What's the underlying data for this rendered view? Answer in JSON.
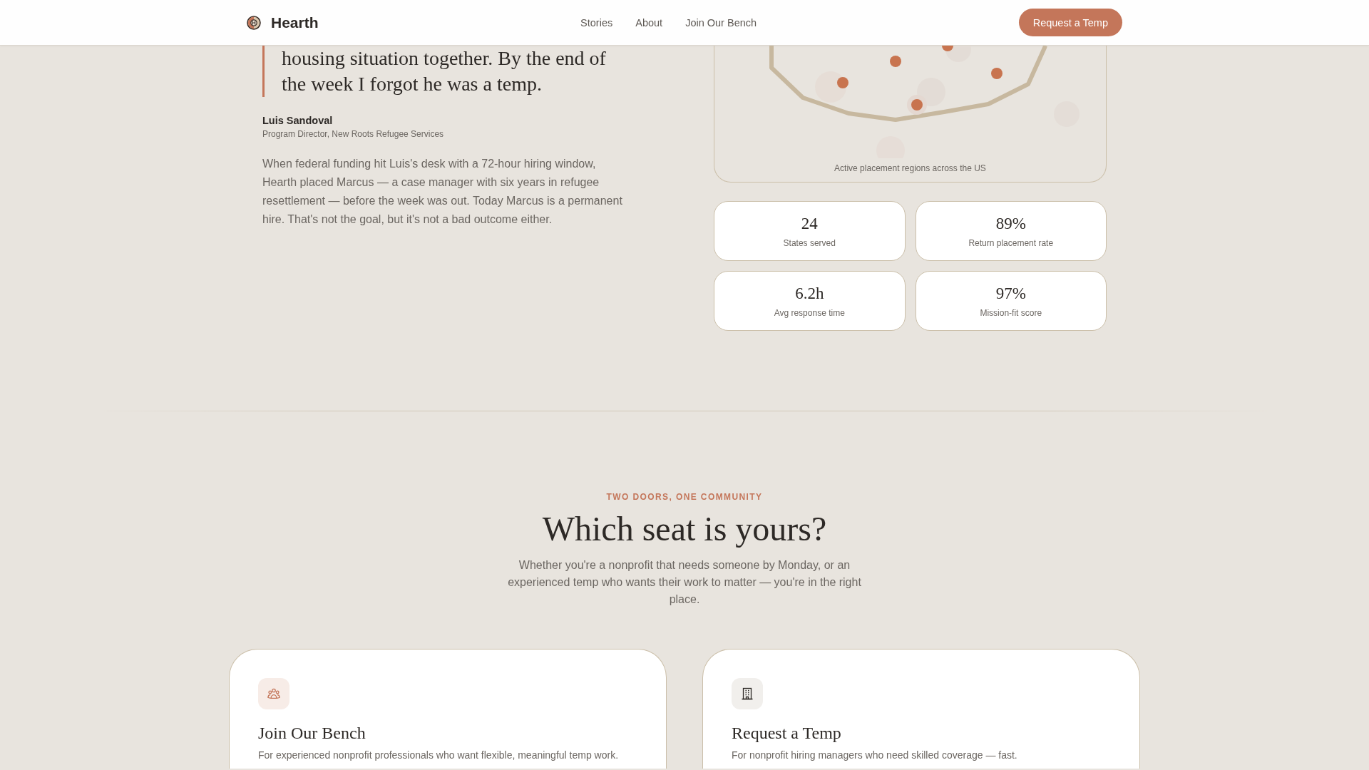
{
  "header": {
    "brand": "Hearth",
    "nav": [
      {
        "label": "Stories"
      },
      {
        "label": "About"
      },
      {
        "label": "Join Our Bench"
      }
    ],
    "cta": "Request a Temp"
  },
  "testimonial": {
    "quote": "housing situation together. By the end of the week I forgot he was a temp.",
    "author": "Luis Sandoval",
    "role": "Program Director, New Roots Refugee Services",
    "story": "When federal funding hit Luis's desk with a 72-hour hiring window, Hearth placed Marcus — a case manager with six years in refugee resettlement — before the week was out. Today Marcus is a permanent hire. That's not the goal, but it's not a bad outcome either."
  },
  "map": {
    "caption": "Active placement regions across the US"
  },
  "stats": [
    {
      "value": "24",
      "label": "States served"
    },
    {
      "value": "89%",
      "label": "Return placement rate"
    },
    {
      "value": "6.2h",
      "label": "Avg response time"
    },
    {
      "value": "97%",
      "label": "Mission-fit score"
    }
  ],
  "seats": {
    "eyebrow": "TWO DOORS, ONE COMMUNITY",
    "title": "Which seat is yours?",
    "intro": "Whether you're a nonprofit that needs someone by Monday, or an experienced temp who wants their work to matter — you're in the right place.",
    "cards": [
      {
        "kind": "bench",
        "title": "Join Our Bench",
        "description": "For experienced nonprofit professionals who want flexible, meaningful temp work."
      },
      {
        "kind": "request",
        "title": "Request a Temp",
        "description": "For nonprofit hiring managers who need skilled coverage — fast."
      }
    ]
  }
}
